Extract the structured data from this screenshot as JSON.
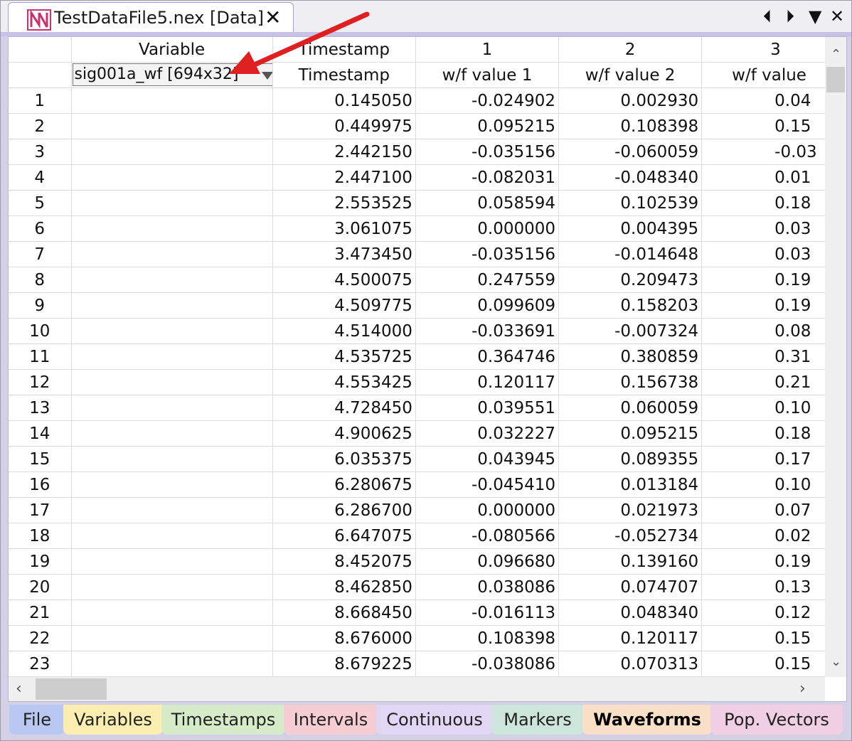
{
  "window": {
    "doc_tab_title": "TestDataFile5.nex [Data]",
    "close_glyph": "✕",
    "nav_left_glyph": "⏴",
    "nav_right_glyph": "⏵",
    "menu_glyph": "▼",
    "window_close_glyph": "✕"
  },
  "table": {
    "header_row1": [
      "Variable",
      "Timestamp",
      "1",
      "2",
      "3"
    ],
    "selected_variable": "sig001a_wf [694x32]",
    "header_row2": [
      "Timestamp",
      "w/f value 1",
      "w/f value 2",
      "w/f value"
    ],
    "rows": [
      {
        "n": "1",
        "ts": "0.145050",
        "v1": "-0.024902",
        "v2": "0.002930",
        "v3": "0.04"
      },
      {
        "n": "2",
        "ts": "0.449975",
        "v1": "0.095215",
        "v2": "0.108398",
        "v3": "0.15"
      },
      {
        "n": "3",
        "ts": "2.442150",
        "v1": "-0.035156",
        "v2": "-0.060059",
        "v3": "-0.03"
      },
      {
        "n": "4",
        "ts": "2.447100",
        "v1": "-0.082031",
        "v2": "-0.048340",
        "v3": "0.01"
      },
      {
        "n": "5",
        "ts": "2.553525",
        "v1": "0.058594",
        "v2": "0.102539",
        "v3": "0.18"
      },
      {
        "n": "6",
        "ts": "3.061075",
        "v1": "0.000000",
        "v2": "0.004395",
        "v3": "0.03"
      },
      {
        "n": "7",
        "ts": "3.473450",
        "v1": "-0.035156",
        "v2": "-0.014648",
        "v3": "0.03"
      },
      {
        "n": "8",
        "ts": "4.500075",
        "v1": "0.247559",
        "v2": "0.209473",
        "v3": "0.19"
      },
      {
        "n": "9",
        "ts": "4.509775",
        "v1": "0.099609",
        "v2": "0.158203",
        "v3": "0.19"
      },
      {
        "n": "10",
        "ts": "4.514000",
        "v1": "-0.033691",
        "v2": "-0.007324",
        "v3": "0.08"
      },
      {
        "n": "11",
        "ts": "4.535725",
        "v1": "0.364746",
        "v2": "0.380859",
        "v3": "0.31"
      },
      {
        "n": "12",
        "ts": "4.553425",
        "v1": "0.120117",
        "v2": "0.156738",
        "v3": "0.21"
      },
      {
        "n": "13",
        "ts": "4.728450",
        "v1": "0.039551",
        "v2": "0.060059",
        "v3": "0.10"
      },
      {
        "n": "14",
        "ts": "4.900625",
        "v1": "0.032227",
        "v2": "0.095215",
        "v3": "0.18"
      },
      {
        "n": "15",
        "ts": "6.035375",
        "v1": "0.043945",
        "v2": "0.089355",
        "v3": "0.17"
      },
      {
        "n": "16",
        "ts": "6.280675",
        "v1": "-0.045410",
        "v2": "0.013184",
        "v3": "0.10"
      },
      {
        "n": "17",
        "ts": "6.286700",
        "v1": "0.000000",
        "v2": "0.021973",
        "v3": "0.07"
      },
      {
        "n": "18",
        "ts": "6.647075",
        "v1": "-0.080566",
        "v2": "-0.052734",
        "v3": "0.02"
      },
      {
        "n": "19",
        "ts": "8.452075",
        "v1": "0.096680",
        "v2": "0.139160",
        "v3": "0.19"
      },
      {
        "n": "20",
        "ts": "8.462850",
        "v1": "0.038086",
        "v2": "0.074707",
        "v3": "0.13"
      },
      {
        "n": "21",
        "ts": "8.668450",
        "v1": "-0.016113",
        "v2": "0.048340",
        "v3": "0.12"
      },
      {
        "n": "22",
        "ts": "8.676000",
        "v1": "0.108398",
        "v2": "0.120117",
        "v3": "0.15"
      },
      {
        "n": "23",
        "ts": "8.679225",
        "v1": "-0.038086",
        "v2": "0.070313",
        "v3": "0.15"
      }
    ]
  },
  "scrollbars": {
    "up_glyph": "⌃",
    "down_glyph": "⌄",
    "left_glyph": "‹",
    "right_glyph": "›"
  },
  "bottom_tabs": [
    {
      "label": "File",
      "color": "#b9c8f2",
      "active": false
    },
    {
      "label": "Variables",
      "color": "#fbeeb0",
      "active": false
    },
    {
      "label": "Timestamps",
      "color": "#d6ebc8",
      "active": false
    },
    {
      "label": "Intervals",
      "color": "#f6cdd2",
      "active": false
    },
    {
      "label": "Continuous",
      "color": "#e1d6f3",
      "active": false
    },
    {
      "label": "Markers",
      "color": "#cde6dc",
      "active": false
    },
    {
      "label": "Waveforms",
      "color": "#fbe0c8",
      "active": true
    },
    {
      "label": "Pop. Vectors",
      "color": "#f0cfe4",
      "active": false
    }
  ],
  "colors": {
    "accent_purple": "#c9c2e8",
    "annotation_arrow": "#e02020",
    "logo": "#c8336e"
  }
}
